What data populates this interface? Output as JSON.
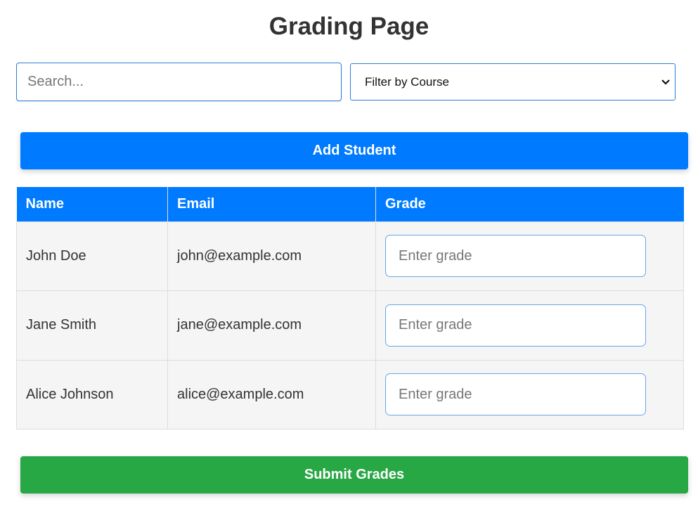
{
  "header": {
    "title": "Grading Page"
  },
  "search": {
    "placeholder": "Search..."
  },
  "course_filter": {
    "selected": "Filter by Course"
  },
  "actions": {
    "add_label": "Add Student",
    "submit_label": "Submit Grades"
  },
  "colors": {
    "primary": "#007bff",
    "success": "#28a745"
  },
  "table": {
    "headers": {
      "name": "Name",
      "email": "Email",
      "grade": "Grade"
    },
    "rows": [
      {
        "name": "John Doe",
        "email": "john@example.com",
        "grade_placeholder": "Enter grade"
      },
      {
        "name": "Jane Smith",
        "email": "jane@example.com",
        "grade_placeholder": "Enter grade"
      },
      {
        "name": "Alice Johnson",
        "email": "alice@example.com",
        "grade_placeholder": "Enter grade"
      }
    ]
  }
}
